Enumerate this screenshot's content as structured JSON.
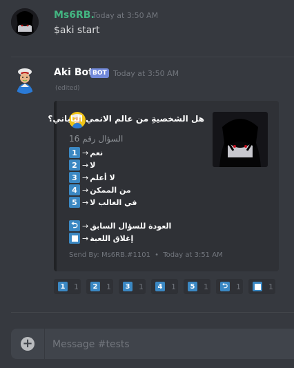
{
  "messages": {
    "user": {
      "username": "Ms6RB.",
      "timestamp": "Today at 3:50 AM",
      "text": "$aki start",
      "name_color": "#43b581"
    },
    "bot": {
      "username": "Aki Bot",
      "tag": "BOT",
      "timestamp": "Today at 3:50 AM",
      "edited": "(edited)"
    }
  },
  "embed": {
    "author": "هل الشخصيةِ من عالم الانمي الياباني؟",
    "subtitle": "السؤال رقم 16",
    "options": [
      {
        "key": "1",
        "label": "نعم"
      },
      {
        "key": "2",
        "label": "لا"
      },
      {
        "key": "3",
        "label": "لا أعلم"
      },
      {
        "key": "4",
        "label": "من الممكن"
      },
      {
        "key": "5",
        "label": "في الغالب لا"
      }
    ],
    "back_label": "العودة للسؤال السابق",
    "close_label": "إغلاق اللعبة",
    "arrow": "→",
    "footer_sender": "Send By: Ms6RB.#1101",
    "footer_dot": "•",
    "footer_time": "Today at 3:51 AM",
    "border_color": "#202225"
  },
  "reactions": [
    {
      "icon": "keycap-1-icon",
      "key": "1",
      "count": "1"
    },
    {
      "icon": "keycap-2-icon",
      "key": "2",
      "count": "1"
    },
    {
      "icon": "keycap-3-icon",
      "key": "3",
      "count": "1"
    },
    {
      "icon": "keycap-4-icon",
      "key": "4",
      "count": "1"
    },
    {
      "icon": "keycap-5-icon",
      "key": "5",
      "count": "1"
    },
    {
      "icon": "back-arrow-icon",
      "key": "⮌",
      "count": "1"
    },
    {
      "icon": "stop-square-icon",
      "key": "",
      "count": "1"
    }
  ],
  "composer": {
    "placeholder": "Message #tests",
    "plus": "+"
  }
}
